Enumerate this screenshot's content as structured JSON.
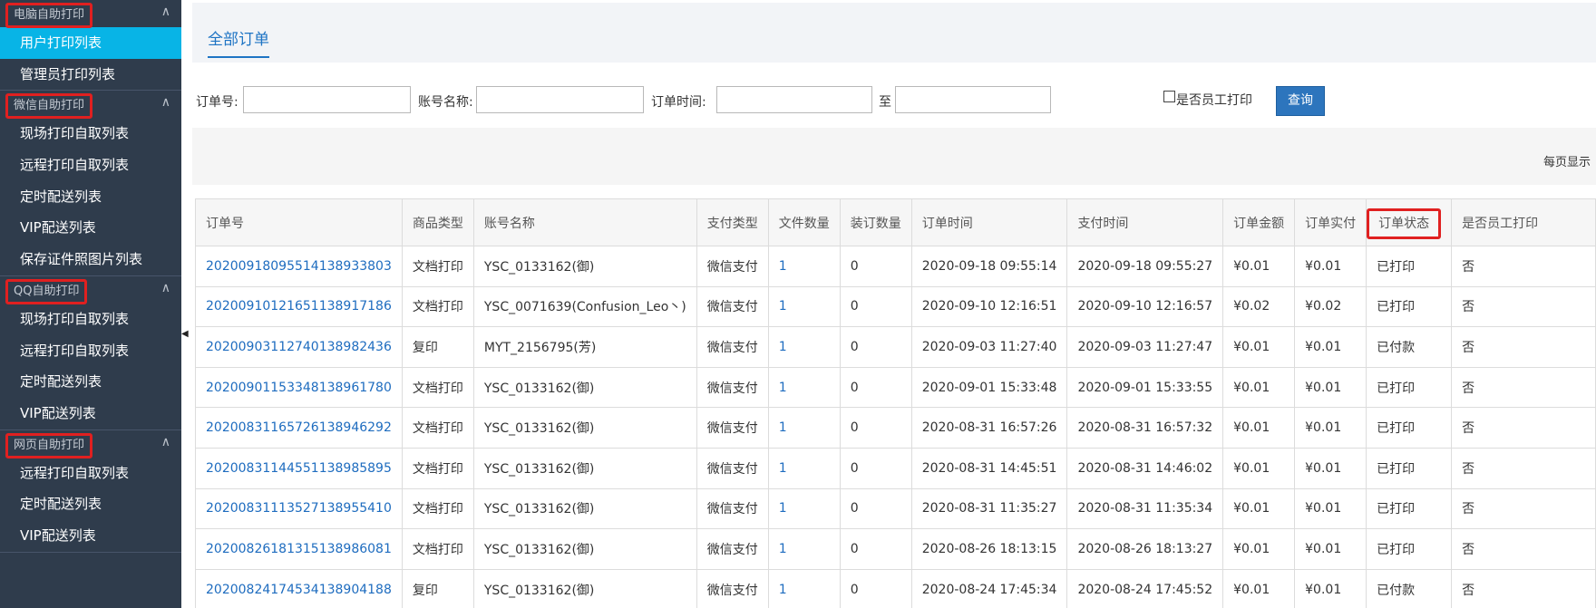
{
  "sidebar": {
    "groups": [
      {
        "title": "电脑自助打印",
        "items": [
          "用户打印列表",
          "管理员打印列表"
        ]
      },
      {
        "title": "微信自助打印",
        "items": [
          "现场打印自取列表",
          "远程打印自取列表",
          "定时配送列表",
          "VIP配送列表",
          "保存证件照图片列表"
        ]
      },
      {
        "title": "QQ自助打印",
        "items": [
          "现场打印自取列表",
          "远程打印自取列表",
          "定时配送列表",
          "VIP配送列表"
        ]
      },
      {
        "title": "网页自助打印",
        "items": [
          "远程打印自取列表",
          "定时配送列表",
          "VIP配送列表"
        ]
      }
    ],
    "active_item": "用户打印列表",
    "group_toggle_icon": "chevron-up-icon",
    "collapse_icon": "triangle-left-icon"
  },
  "tabs": {
    "all_orders": "全部订单"
  },
  "filter": {
    "order_no_label": "订单号:",
    "order_no_value": "",
    "account_label": "账号名称:",
    "account_value": "",
    "time_label": "订单时间:",
    "time_from_value": "",
    "to_label": "至",
    "time_to_value": "",
    "employee_checkbox_label": "是否员工打印",
    "employee_checked": false,
    "query_button": "查询"
  },
  "pagination": {
    "per_page_label": "每页显示"
  },
  "table": {
    "columns": [
      "订单号",
      "商品类型",
      "账号名称",
      "支付类型",
      "文件数量",
      "装订数量",
      "订单时间",
      "支付时间",
      "订单金额",
      "订单实付",
      "订单状态",
      "是否员工打印"
    ],
    "highlighted_column": "订单状态",
    "rows": [
      [
        "20200918095514138933803",
        "文档打印",
        "YSC_0133162(御)",
        "微信支付",
        "1",
        "0",
        "2020-09-18 09:55:14",
        "2020-09-18 09:55:27",
        "¥0.01",
        "¥0.01",
        "已打印",
        "否"
      ],
      [
        "20200910121651138917186",
        "文档打印",
        "YSC_0071639(Confusion_Leo丶)",
        "微信支付",
        "1",
        "0",
        "2020-09-10 12:16:51",
        "2020-09-10 12:16:57",
        "¥0.02",
        "¥0.02",
        "已打印",
        "否"
      ],
      [
        "20200903112740138982436",
        "复印",
        "MYT_2156795(芳)",
        "微信支付",
        "1",
        "0",
        "2020-09-03 11:27:40",
        "2020-09-03 11:27:47",
        "¥0.01",
        "¥0.01",
        "已付款",
        "否"
      ],
      [
        "20200901153348138961780",
        "文档打印",
        "YSC_0133162(御)",
        "微信支付",
        "1",
        "0",
        "2020-09-01 15:33:48",
        "2020-09-01 15:33:55",
        "¥0.01",
        "¥0.01",
        "已打印",
        "否"
      ],
      [
        "20200831165726138946292",
        "文档打印",
        "YSC_0133162(御)",
        "微信支付",
        "1",
        "0",
        "2020-08-31 16:57:26",
        "2020-08-31 16:57:32",
        "¥0.01",
        "¥0.01",
        "已打印",
        "否"
      ],
      [
        "20200831144551138985895",
        "文档打印",
        "YSC_0133162(御)",
        "微信支付",
        "1",
        "0",
        "2020-08-31 14:45:51",
        "2020-08-31 14:46:02",
        "¥0.01",
        "¥0.01",
        "已打印",
        "否"
      ],
      [
        "20200831113527138955410",
        "文档打印",
        "YSC_0133162(御)",
        "微信支付",
        "1",
        "0",
        "2020-08-31 11:35:27",
        "2020-08-31 11:35:34",
        "¥0.01",
        "¥0.01",
        "已打印",
        "否"
      ],
      [
        "20200826181315138986081",
        "文档打印",
        "YSC_0133162(御)",
        "微信支付",
        "1",
        "0",
        "2020-08-26 18:13:15",
        "2020-08-26 18:13:27",
        "¥0.01",
        "¥0.01",
        "已打印",
        "否"
      ],
      [
        "20200824174534138904188",
        "复印",
        "YSC_0133162(御)",
        "微信支付",
        "1",
        "0",
        "2020-08-24 17:45:34",
        "2020-08-24 17:45:52",
        "¥0.01",
        "¥0.01",
        "已付款",
        "否"
      ]
    ]
  },
  "colors": {
    "sidebar_bg": "#2f3c4c",
    "active_item": "#08b4e6",
    "accent": "#1e74c4",
    "highlight_border": "#e02020",
    "button": "#2d75bd"
  }
}
